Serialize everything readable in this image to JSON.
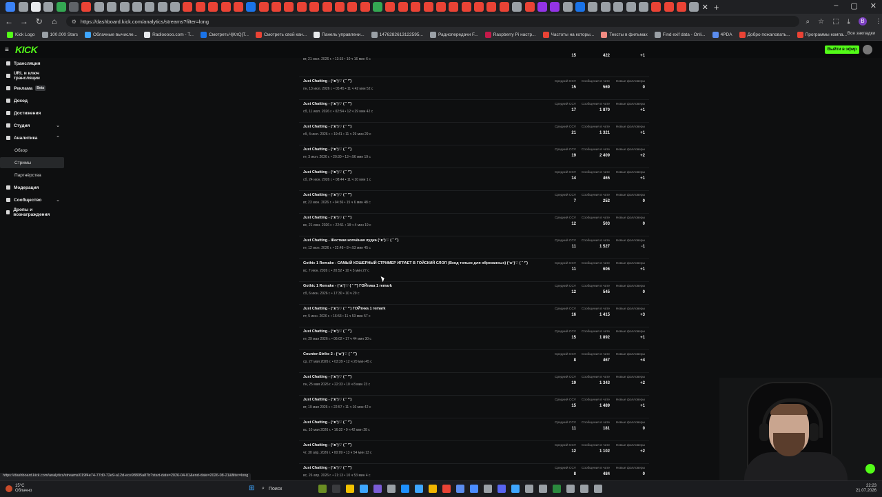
{
  "browser": {
    "url": "https://dashboard.kick.com/analytics/streams?filter=long",
    "bookmarks": [
      "Kick Logo",
      "100.000 Stars",
      "Облачные вычисле...",
      "Radiooooo.com - T...",
      "СмотретьЧ|КлQ|Т...",
      "Смотреть свой кан...",
      "Панель управлени...",
      "1476282613122595...",
      "Радиопередачи F...",
      "Raspberry Pi настр...",
      "Частоты на которы...",
      "Тексты в фильмах",
      "Find exif data - Onli...",
      "4PDA",
      "Добро пожаловать...",
      "Программы компа..."
    ],
    "bookmarks_all": "Все закладки",
    "tab_colors": [
      "#3b82f6",
      "#9aa0a6",
      "#e8eaed",
      "#9aa0a6",
      "#34a853",
      "#5f6368",
      "#ea4335",
      "#9aa0a6",
      "#9aa0a6",
      "#9aa0a6",
      "#9aa0a6",
      "#9aa0a6",
      "#9aa0a6",
      "#9aa0a6",
      "#ea4335",
      "#ea4335",
      "#ea4335",
      "#ea4335",
      "#ea4335",
      "#1a73e8",
      "#ea4335",
      "#ea4335",
      "#ea4335",
      "#ea4335",
      "#ea4335",
      "#ea4335",
      "#ea4335",
      "#ea4335",
      "#ea4335",
      "#34a853",
      "#ea4335",
      "#ea4335",
      "#ea4335",
      "#ea4335",
      "#ea4335",
      "#ea4335",
      "#ea4335",
      "#ea4335",
      "#ea4335",
      "#ea4335",
      "#9aa0a6",
      "#ea4335",
      "#9334e6",
      "#9334e6",
      "#9aa0a6",
      "#1a73e8",
      "#9aa0a6",
      "#9aa0a6",
      "#9aa0a6",
      "#9aa0a6",
      "#9aa0a6",
      "#ea4335",
      "#ea4335",
      "#ea4335",
      "#9aa0a6"
    ],
    "profile_letter": "B"
  },
  "site": {
    "logo": "KICK",
    "go_live": "Выйти в эфир"
  },
  "sidebar": {
    "items": [
      {
        "label": "Трансляция",
        "type": "item"
      },
      {
        "label": "URL и ключ трансляции",
        "type": "item"
      },
      {
        "label": "Реклама",
        "type": "item",
        "badge": "Beta"
      },
      {
        "label": "Доход",
        "type": "item"
      },
      {
        "label": "Достижения",
        "type": "item"
      },
      {
        "label": "Студия",
        "type": "item",
        "chevron": "down"
      },
      {
        "label": "Аналитика",
        "type": "item",
        "chevron": "up"
      },
      {
        "label": "Обзор",
        "type": "sub"
      },
      {
        "label": "Стримы",
        "type": "sub",
        "active": true
      },
      {
        "label": "Партнёрства",
        "type": "sub"
      },
      {
        "label": "Модерация",
        "type": "item"
      },
      {
        "label": "Сообщество",
        "type": "item",
        "chevron": "down"
      },
      {
        "label": "Дропы и вознаграждения",
        "type": "item"
      }
    ]
  },
  "stat_labels": {
    "ccv": "Средний CCV",
    "messages": "Сообщения в чате",
    "followers": "Новые фолловеры"
  },
  "streams": [
    {
      "title": "",
      "meta": "вт, 21 июл. 2026 г.  •  13:15  •  10 ч 16 мин 6 с",
      "ccv": "15",
      "messages": "422",
      "followers": "+1",
      "partial": true
    },
    {
      "title": "Just Chatting - (ᵔᴥᵔ)♡ ( ˘ ³˘)",
      "meta": "пн, 13 июл. 2026 г.  •  05:45  •  11 ч 42 мин 52 с",
      "ccv": "15",
      "messages": "569",
      "followers": "0"
    },
    {
      "title": "Just Chatting - (ᵔᴥᵔ)♡ ( ˘ ³˘)",
      "meta": "сб, 11 июл. 2026 г.  •  02:54  •  12 ч 29 мин 42 с",
      "ccv": "17",
      "messages": "1 870",
      "followers": "+1"
    },
    {
      "title": "Just Chatting - (ᵔᴥᵔ)♡ ( ˘ ³˘)",
      "meta": "сб, 4 июл. 2026 г.  •  19:41  •  11 ч 29 мин 29 с",
      "ccv": "21",
      "messages": "1 321",
      "followers": "+1"
    },
    {
      "title": "Just Chatting - (ᵔᴥᵔ)♡ ( ˘ ³˘)",
      "meta": "пт, 3 июл. 2026 г.  •  20:30  •  13 ч 56 мин 19 с",
      "ccv": "19",
      "messages": "2 409",
      "followers": "+2"
    },
    {
      "title": "Just Chatting - (ᵔᴥᵔ)♡ ( ˘ ³˘)",
      "meta": "сб, 24 июн. 2026 г.  •  08:44  •  11 ч 10 мин 1 с",
      "ccv": "14",
      "messages": "465",
      "followers": "+1"
    },
    {
      "title": "Just Chatting - (ᵔᴥᵔ)♡ ( ˘ ³˘)",
      "meta": "вт, 23 июн. 2026 г.  •  04:36  •  15 ч 6 мин 48 с",
      "ccv": "7",
      "messages": "252",
      "followers": "0"
    },
    {
      "title": "Just Chatting - (ᵔᴥᵔ)♡ ( ˘ ³˘)",
      "meta": "вс, 21 июн. 2026 г.  •  22:51  •  18 ч 4 мин 19 с",
      "ccv": "12",
      "messages": "503",
      "followers": "0"
    },
    {
      "title": "Just Chatting - Жесткая копчёная лудка (ᵔᴥᵔ)♡ ( ˘ ³˘)",
      "meta": "пт, 12 июн. 2026 г.  •  22:48  •  8 ч 53 мин 45 с",
      "ccv": "11",
      "messages": "1 527",
      "followers": "-1"
    },
    {
      "title": "Gothic 1 Remake - САМЫЙ КОШЕРНЫЙ СТРИМЕР ИГРАЕТ В ГОЙСКИЙ СЛОП (Вход только для обрезанных) (ᵔᴥᵔ)♡ ( ˘ ³˘)",
      "meta": "вс, 7 июн. 2026 г.  •  20:52  •  10 ч 5 мин 27 с",
      "ccv": "11",
      "messages": "606",
      "followers": "+1"
    },
    {
      "title": "Gothic 1 Remake - (ᵔᴥᵔ)♡ ( ˘ ³˘) ГОЙтика 1 remark",
      "meta": "сб, 6 июн. 2026 г.  •  17:30  •  10 ч 29 с",
      "ccv": "12",
      "messages": "545",
      "followers": "0"
    },
    {
      "title": "Just Chatting - (ᵔᴥᵔ)♡ ( ˘ ³˘) ГОЙтика 1 remark",
      "meta": "пт, 5 июн. 2026 г.  •  16:53  •  11 ч 53 мин 57 с",
      "ccv": "16",
      "messages": "1 415",
      "followers": "+3"
    },
    {
      "title": "Just Chatting - (ᵔᴥᵔ)♡ ( ˘ ³˘)",
      "meta": "пт, 29 мая 2026 г.  •  06:02  •  17 ч 44 мин 30 с",
      "ccv": "15",
      "messages": "1 892",
      "followers": "+1"
    },
    {
      "title": "Counter-Strike 2 - (ᵔᴥᵔ)♡ ( ˘ ³˘)",
      "meta": "ср, 27 мая 2026 г.  •  03:39  •  12 ч 20 мин 45 с",
      "ccv": "8",
      "messages": "467",
      "followers": "+4"
    },
    {
      "title": "Just Chatting - (ᵔᴥᵔ)♡ ( ˘ ³˘)",
      "meta": "пн, 25 мая 2026 г.  •  22:33  •  10 ч 8 мин 23 с",
      "ccv": "19",
      "messages": "1 343",
      "followers": "+2"
    },
    {
      "title": "Just Chatting - (ᵔᴥᵔ)♡ ( ˘ ³˘)",
      "meta": "вт, 19 мая 2026 г.  •  22:57  •  11 ч 16 мин 42 с",
      "ccv": "15",
      "messages": "1 489",
      "followers": "+1"
    },
    {
      "title": "Just Chatting - (ᵔᴥᵔ)♡ ( ˘ ³˘)",
      "meta": "вс, 10 мая 2026 г.  •  16:32  •  9 ч 42 мин 28 с",
      "ccv": "11",
      "messages": "181",
      "followers": "0"
    },
    {
      "title": "Just Chatting - (ᵔᴥᵔ)♡ ( ˘ ³˘)",
      "meta": "чт, 30 апр. 2026 г.  •  00:09  •  13 ч 54 мин 13 с",
      "ccv": "12",
      "messages": "1 102",
      "followers": "+2"
    },
    {
      "title": "Just Chatting - (ᵔᴥᵔ)♡ ( ˘ ³˘)",
      "meta": "вс, 26 апр. 2026 г.  •  21:13  •  10 ч 53 мин 4 с",
      "ccv": "8",
      "messages": "484",
      "followers": "0"
    }
  ],
  "status_bar": "https://dashboard.kick.com/analytics/streams/019f4e74-77d0-72e9-a12d-ece98805a87b?start-date=2026-04-01&end-date=2026-08-21&filter=long",
  "taskbar": {
    "weather_temp": "15°C",
    "weather_desc": "Облачно",
    "search": "Поиск",
    "time": "22:23",
    "date": "21.07.2026",
    "app_colors": [
      "#6b8e23",
      "#3a3b3e",
      "#f2c200",
      "#3ea6ff",
      "#7b5cd6",
      "#9aa0a6",
      "#1e90ff",
      "#3ea6ff",
      "#f2b600",
      "#ea4335",
      "#5b8def",
      "#4a8cff",
      "#9aa0a6",
      "#5865f2",
      "#3ea6ff",
      "#9aa0a6",
      "#9aa0a6",
      "#2b8a3e",
      "#9aa0a6",
      "#9aa0a6",
      "#9aa0a6"
    ]
  },
  "colors": {
    "kick_green": "#53fc18",
    "background": "#0e0f10"
  }
}
